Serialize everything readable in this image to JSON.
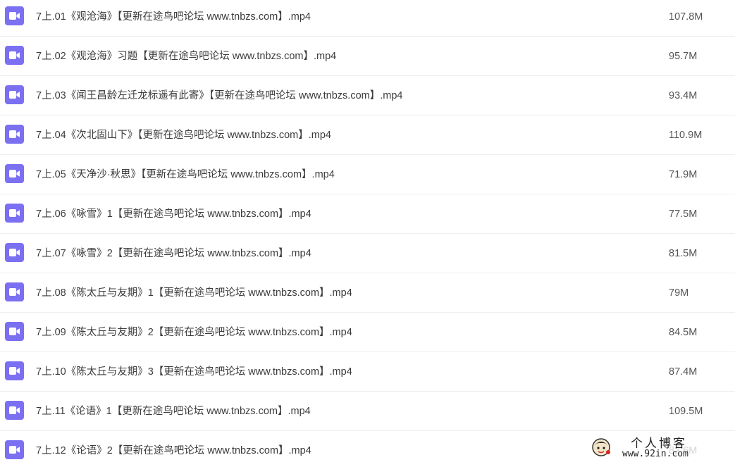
{
  "files": [
    {
      "name": "7上.01《观沧海》【更新在途鸟吧论坛 www.tnbzs.com】.mp4",
      "size": "107.8M",
      "icon": "video-file-icon"
    },
    {
      "name": "7上.02《观沧海》习题【更新在途鸟吧论坛 www.tnbzs.com】.mp4",
      "size": "95.7M",
      "icon": "video-file-icon"
    },
    {
      "name": "7上.03《闻王昌龄左迁龙标遥有此寄》【更新在途鸟吧论坛 www.tnbzs.com】.mp4",
      "size": "93.4M",
      "icon": "video-file-icon"
    },
    {
      "name": "7上.04《次北固山下》【更新在途鸟吧论坛 www.tnbzs.com】.mp4",
      "size": "110.9M",
      "icon": "video-file-icon"
    },
    {
      "name": "7上.05《天净沙·秋思》【更新在途鸟吧论坛 www.tnbzs.com】.mp4",
      "size": "71.9M",
      "icon": "video-file-icon"
    },
    {
      "name": "7上.06《咏雪》1【更新在途鸟吧论坛 www.tnbzs.com】.mp4",
      "size": "77.5M",
      "icon": "video-file-icon"
    },
    {
      "name": "7上.07《咏雪》2【更新在途鸟吧论坛 www.tnbzs.com】.mp4",
      "size": "81.5M",
      "icon": "video-file-icon"
    },
    {
      "name": "7上.08《陈太丘与友期》1【更新在途鸟吧论坛 www.tnbzs.com】.mp4",
      "size": "79M",
      "icon": "video-file-icon"
    },
    {
      "name": "7上.09《陈太丘与友期》2【更新在途鸟吧论坛 www.tnbzs.com】.mp4",
      "size": "84.5M",
      "icon": "video-file-icon"
    },
    {
      "name": "7上.10《陈太丘与友期》3【更新在途鸟吧论坛 www.tnbzs.com】.mp4",
      "size": "87.4M",
      "icon": "video-file-icon"
    },
    {
      "name": "7上.11《论语》1【更新在途鸟吧论坛 www.tnbzs.com】.mp4",
      "size": "109.5M",
      "icon": "video-file-icon"
    },
    {
      "name": "7上.12《论语》2【更新在途鸟吧论坛 www.tnbzs.com】.mp4",
      "size": "82.6M",
      "icon": "video-file-icon"
    }
  ],
  "watermark": {
    "title": "个人博客",
    "url": "www.92in.com"
  },
  "colors": {
    "icon_bg": "#7b6ff2",
    "text": "#3b3b3b",
    "divider": "#eeeeee"
  }
}
